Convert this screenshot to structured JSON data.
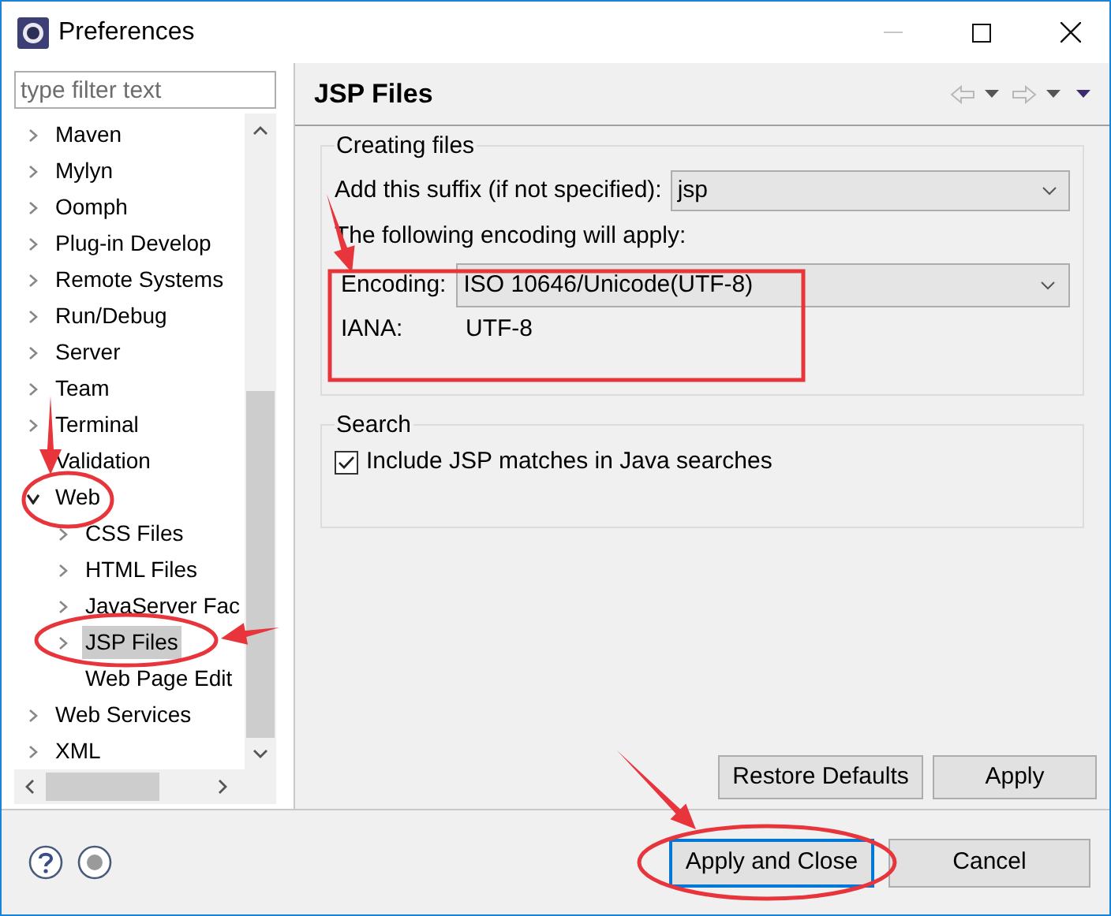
{
  "window": {
    "title": "Preferences",
    "minimize_disabled": true
  },
  "filter": {
    "placeholder": "type filter text"
  },
  "tree": [
    {
      "label": "Maven",
      "expandable": true,
      "expanded": false,
      "selected": false
    },
    {
      "label": "Mylyn",
      "expandable": true,
      "expanded": false,
      "selected": false
    },
    {
      "label": "Oomph",
      "expandable": true,
      "expanded": false,
      "selected": false
    },
    {
      "label": "Plug-in Develop",
      "expandable": true,
      "expanded": false,
      "selected": false
    },
    {
      "label": "Remote Systems",
      "expandable": true,
      "expanded": false,
      "selected": false
    },
    {
      "label": "Run/Debug",
      "expandable": true,
      "expanded": false,
      "selected": false
    },
    {
      "label": "Server",
      "expandable": true,
      "expanded": false,
      "selected": false
    },
    {
      "label": "Team",
      "expandable": true,
      "expanded": false,
      "selected": false
    },
    {
      "label": "Terminal",
      "expandable": true,
      "expanded": false,
      "selected": false
    },
    {
      "label": "Validation",
      "expandable": false,
      "selected": false
    },
    {
      "label": "Web",
      "expandable": true,
      "expanded": true,
      "selected": false,
      "children": [
        {
          "label": "CSS Files",
          "expandable": true,
          "expanded": false,
          "selected": false
        },
        {
          "label": "HTML Files",
          "expandable": true,
          "expanded": false,
          "selected": false
        },
        {
          "label": "JavaServer Fac",
          "expandable": true,
          "expanded": false,
          "selected": false
        },
        {
          "label": "JSP Files",
          "expandable": true,
          "expanded": false,
          "selected": true
        },
        {
          "label": "Web Page Edit",
          "expandable": false,
          "selected": false
        }
      ]
    },
    {
      "label": "Web Services",
      "expandable": true,
      "expanded": false,
      "selected": false
    },
    {
      "label": "XML",
      "expandable": true,
      "expanded": false,
      "selected": false
    }
  ],
  "page": {
    "title": "JSP Files",
    "creating_group": {
      "legend": "Creating files",
      "suffix_label": "Add this suffix (if not specified):",
      "suffix_value": "jsp",
      "encoding_note": "The following encoding will apply:",
      "encoding_label": "Encoding:",
      "encoding_value": "ISO 10646/Unicode(UTF-8)",
      "iana_label": "IANA:",
      "iana_value": "UTF-8"
    },
    "search_group": {
      "legend": "Search",
      "checkbox_label": "Include JSP matches in Java searches",
      "checked": true
    },
    "buttons": [
      {
        "label": "Restore Defaults"
      },
      {
        "label": "Apply"
      }
    ]
  },
  "footer_buttons": [
    {
      "label": "Apply and Close",
      "focused": true
    },
    {
      "label": "Cancel",
      "focused": false
    }
  ],
  "annotations": [
    {
      "kind": "arrow"
    },
    {
      "kind": "ellipse"
    },
    {
      "kind": "arrow"
    },
    {
      "kind": "ellipse"
    },
    {
      "kind": "arrow"
    },
    {
      "kind": "rect"
    },
    {
      "kind": "arrow"
    },
    {
      "kind": "ellipse"
    }
  ]
}
